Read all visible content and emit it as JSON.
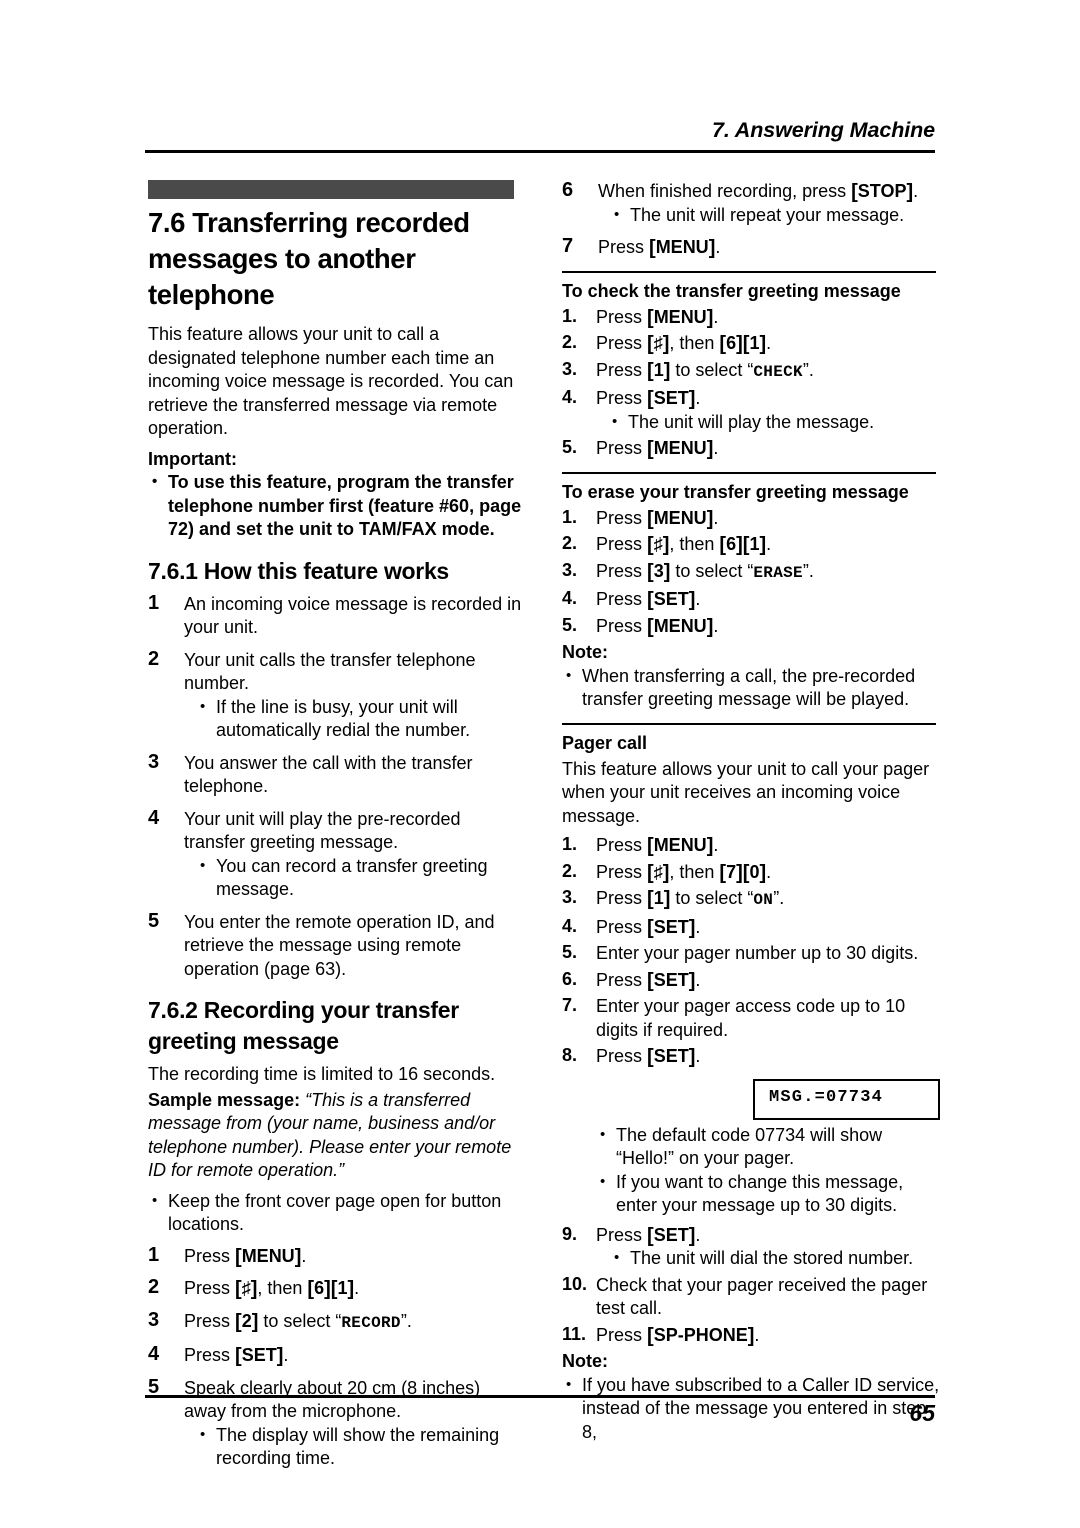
{
  "header": {
    "chapter": "7. Answering Machine"
  },
  "footer": {
    "page_number": "65"
  },
  "left_column": {
    "section_title": "7.6 Transferring recorded messages to another telephone",
    "intro": "This feature allows your unit to call a designated telephone number each time an incoming voice message is recorded. You can retrieve the transferred message via remote operation.",
    "important_label": "Important:",
    "important_bullets": [
      "To use this feature, program the transfer telephone number first (feature #60, page 72) and set the unit to TAM/FAX mode."
    ],
    "subsection_1_title": "7.6.1 How this feature works",
    "how_steps": [
      {
        "num": "1",
        "text": "An incoming voice message is recorded in your unit.",
        "bullets": []
      },
      {
        "num": "2",
        "text": "Your unit calls the transfer telephone number.",
        "bullets": [
          "If the line is busy, your unit will automatically redial the number."
        ]
      },
      {
        "num": "3",
        "text": "You answer the call with the transfer telephone.",
        "bullets": []
      },
      {
        "num": "4",
        "text": "Your unit will play the pre-recorded transfer greeting message.",
        "bullets": [
          "You can record a transfer greeting message."
        ]
      },
      {
        "num": "5",
        "text": "You enter the remote operation ID, and retrieve the message using remote operation (page 63).",
        "bullets": []
      }
    ],
    "subsection_2_title": "7.6.2 Recording your transfer greeting message",
    "recording_intro": "The recording time is limited to 16 seconds.",
    "sample_label": "Sample message:",
    "sample_text": "“This is a transferred message from (your name, business and/or telephone number). Please enter your remote ID for remote operation.”",
    "cover_bullets": [
      "Keep the front cover page open for button locations."
    ],
    "record_steps": [
      {
        "num": "1",
        "prefix": "Press ",
        "keys": [
          "MENU"
        ],
        "suffix": ".",
        "bullets": []
      },
      {
        "num": "2",
        "prefix": "Press ",
        "keys": [
          "♯"
        ],
        "mid": ", then ",
        "keys2": [
          "6",
          "1"
        ],
        "suffix": ".",
        "bullets": []
      },
      {
        "num": "3",
        "prefix": "Press ",
        "keys": [
          "2"
        ],
        "mid": " to select “",
        "select": "RECORD",
        "suffix": "”.",
        "bullets": []
      },
      {
        "num": "4",
        "prefix": "Press ",
        "keys": [
          "SET"
        ],
        "suffix": ".",
        "bullets": []
      },
      {
        "num": "5",
        "text": "Speak clearly about 20 cm (8 inches) away from the microphone.",
        "bullets": [
          "The display will show the remaining recording time."
        ]
      }
    ]
  },
  "right_column": {
    "record_steps_cont": [
      {
        "num": "6",
        "prefix": "When finished recording, press ",
        "keys": [
          "STOP"
        ],
        "suffix": ".",
        "bullets": [
          "The unit will repeat your message."
        ]
      },
      {
        "num": "7",
        "prefix": "Press ",
        "keys": [
          "MENU"
        ],
        "suffix": ".",
        "bullets": []
      }
    ],
    "check_section": {
      "title": "To check the transfer greeting message",
      "steps": [
        {
          "num": "1.",
          "prefix": "Press ",
          "keys": [
            "MENU"
          ],
          "suffix": ".",
          "bullets": []
        },
        {
          "num": "2.",
          "prefix": "Press ",
          "keys": [
            "♯"
          ],
          "mid": ", then ",
          "keys2": [
            "6",
            "1"
          ],
          "suffix": ".",
          "bullets": []
        },
        {
          "num": "3.",
          "prefix": "Press ",
          "keys": [
            "1"
          ],
          "mid": " to select “",
          "select": "CHECK",
          "suffix": "”.",
          "bullets": []
        },
        {
          "num": "4.",
          "prefix": "Press ",
          "keys": [
            "SET"
          ],
          "suffix": ".",
          "bullets": [
            "The unit will play the message."
          ]
        },
        {
          "num": "5.",
          "prefix": "Press ",
          "keys": [
            "MENU"
          ],
          "suffix": ".",
          "bullets": []
        }
      ]
    },
    "erase_section": {
      "title": "To erase your transfer greeting message",
      "steps": [
        {
          "num": "1.",
          "prefix": "Press ",
          "keys": [
            "MENU"
          ],
          "suffix": ".",
          "bullets": []
        },
        {
          "num": "2.",
          "prefix": "Press ",
          "keys": [
            "♯"
          ],
          "mid": ", then ",
          "keys2": [
            "6",
            "1"
          ],
          "suffix": ".",
          "bullets": []
        },
        {
          "num": "3.",
          "prefix": "Press ",
          "keys": [
            "3"
          ],
          "mid": " to select “",
          "select": "ERASE",
          "suffix": "”.",
          "bullets": []
        },
        {
          "num": "4.",
          "prefix": "Press ",
          "keys": [
            "SET"
          ],
          "suffix": ".",
          "bullets": []
        },
        {
          "num": "5.",
          "prefix": "Press ",
          "keys": [
            "MENU"
          ],
          "suffix": ".",
          "bullets": []
        }
      ],
      "note_label": "Note:",
      "note_bullets": [
        "When transferring a call, the pre-recorded transfer greeting message will be played."
      ]
    },
    "pager_section": {
      "title": "Pager call",
      "intro": "This feature allows your unit to call your pager when your unit receives an incoming voice message.",
      "steps": [
        {
          "num": "1.",
          "prefix": "Press ",
          "keys": [
            "MENU"
          ],
          "suffix": ".",
          "bullets": []
        },
        {
          "num": "2.",
          "prefix": "Press ",
          "keys": [
            "♯"
          ],
          "mid": ", then ",
          "keys2": [
            "7",
            "0"
          ],
          "suffix": ".",
          "bullets": []
        },
        {
          "num": "3.",
          "prefix": "Press ",
          "keys": [
            "1"
          ],
          "mid": " to select “",
          "select": "ON",
          "suffix": "”.",
          "bullets": []
        },
        {
          "num": "4.",
          "prefix": "Press ",
          "keys": [
            "SET"
          ],
          "suffix": ".",
          "bullets": []
        },
        {
          "num": "5.",
          "text": "Enter your pager number up to 30 digits.",
          "bullets": []
        },
        {
          "num": "6.",
          "prefix": "Press ",
          "keys": [
            "SET"
          ],
          "suffix": ".",
          "bullets": []
        },
        {
          "num": "7.",
          "text": "Enter your pager access code up to 10 digits if required.",
          "bullets": []
        },
        {
          "num": "8.",
          "prefix": "Press ",
          "keys": [
            "SET"
          ],
          "suffix": ".",
          "bullets": []
        }
      ],
      "lcd_display": "MSG.=07734",
      "after_display_bullets": [
        "The default code 07734 will show “Hello!” on your pager.",
        "If you want to change this message, enter your message up to 30 digits."
      ],
      "steps_cont": [
        {
          "num": "9.",
          "prefix": "Press ",
          "keys": [
            "SET"
          ],
          "suffix": ".",
          "bullets": [
            "The unit will dial the stored number."
          ]
        },
        {
          "num": "10.",
          "text": "Check that your pager received the pager test call.",
          "bullets": []
        },
        {
          "num": "11.",
          "prefix": "Press ",
          "keys": [
            "SP-PHONE"
          ],
          "suffix": ".",
          "bullets": []
        }
      ],
      "note_label": "Note:",
      "note_bullets": [
        "If you have subscribed to a Caller ID service, instead of the message you entered in step 8,"
      ]
    }
  }
}
